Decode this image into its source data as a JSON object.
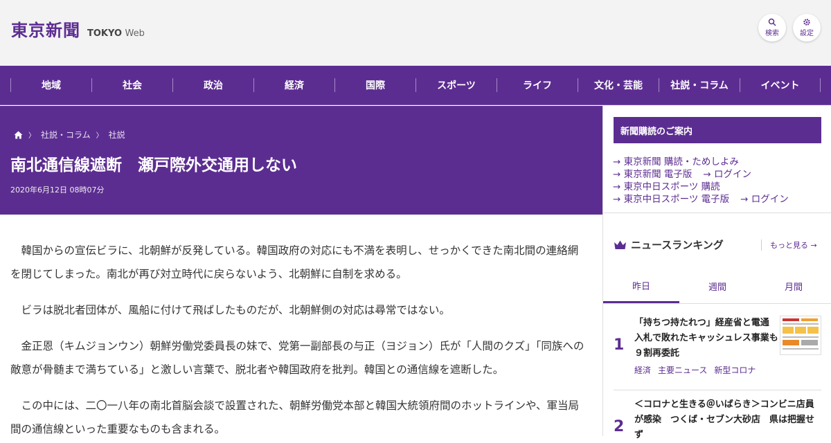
{
  "header": {
    "logo_ja": "東京新聞",
    "logo_en_bold": "TOKYO",
    "logo_en_light": "Web",
    "search_label": "検索",
    "settings_label": "設定"
  },
  "nav": [
    "地域",
    "社会",
    "政治",
    "経済",
    "国際",
    "スポーツ",
    "ライフ",
    "文化・芸能",
    "社説・コラム",
    "イベント"
  ],
  "breadcrumb": {
    "level1": "社説・コラム",
    "level2": "社説"
  },
  "article": {
    "title": "南北通信線遮断　瀬戸際外交通用しない",
    "date": "2020年6月12日 08時07分",
    "paragraphs": [
      "韓国からの宣伝ビラに、北朝鮮が反発している。韓国政府の対応にも不満を表明し、せっかくできた南北間の連絡網を閉じてしまった。南北が再び対立時代に戻らないよう、北朝鮮に自制を求める。",
      "ビラは脱北者団体が、風船に付けて飛ばしたものだが、北朝鮮側の対応は尋常ではない。",
      "金正恩（キムジョンウン）朝鮮労働党委員長の妹で、党第一副部長の与正（ヨジョン）氏が「人間のクズ」「同族への敵意が骨髄まで満ちている」と激しい言葉で、脱北者や韓国政府を批判。韓国との通信線を遮断した。",
      "この中には、二〇一八年の南北首脳会談で設置された、朝鮮労働党本部と韓国大統領府間のホットラインや、軍当局間の通信線といった重要なものも含まれる。"
    ]
  },
  "sidebar": {
    "subscribe_title": "新聞購読のご案内",
    "links": {
      "l1": "東京新聞 購読・ためしよみ",
      "l2": "東京新聞 電子版",
      "l3": "ログイン",
      "l4": "東京中日スポーツ 購読",
      "l5": "東京中日スポーツ 電子版",
      "l6": "ログイン"
    },
    "ranking_title": "ニュースランキング",
    "more": "もっと見る",
    "tabs": [
      "昨日",
      "週間",
      "月間"
    ],
    "items": [
      {
        "rank": "1",
        "title": "「持ちつ持たれつ」経産省と電通　入札で敗れたキャッシュレス事業も９割再委託",
        "tags": [
          "経済",
          "主要ニュース",
          "新型コロナ"
        ]
      },
      {
        "rank": "2",
        "title": "＜コロナと生きる＠いばらき＞コンビニ店員が感染　つくば・セブン大砂店　県は把握せず"
      }
    ]
  },
  "colors": {
    "brand": "#5c2d91"
  }
}
